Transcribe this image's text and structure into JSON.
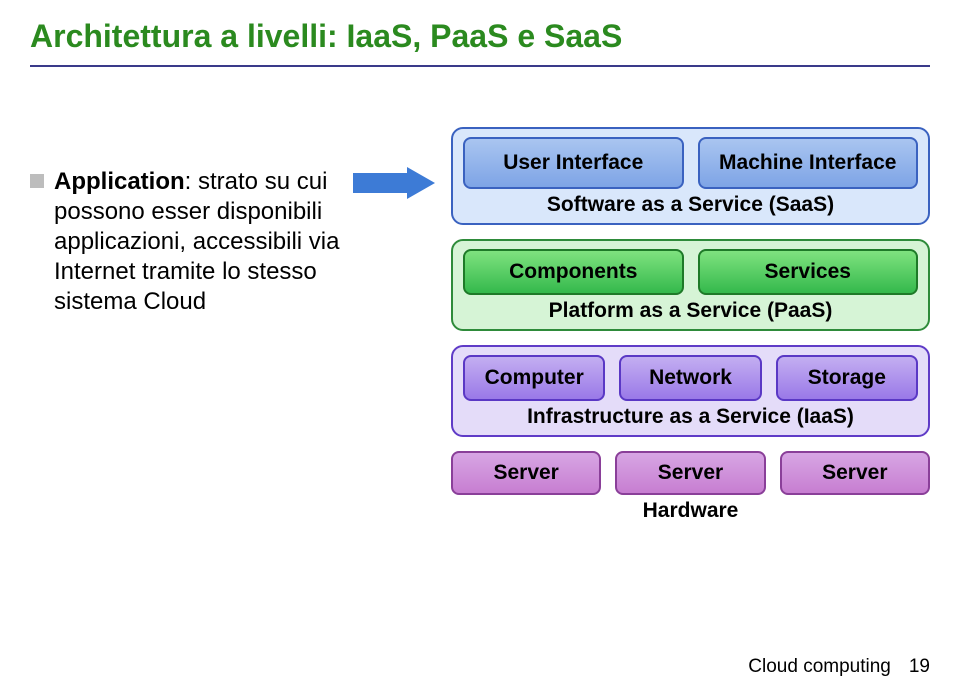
{
  "title": "Architettura a livelli: IaaS, PaaS e SaaS",
  "bullet": {
    "lead": "Application",
    "rest": ": strato su cui possono esser disponibili applicazioni, accessibili via Internet tramite lo stesso sistema Cloud"
  },
  "diagram": {
    "saas": {
      "left": "User Interface",
      "right": "Machine Interface",
      "label": "Software as a Service (SaaS)"
    },
    "paas": {
      "left": "Components",
      "right": "Services",
      "label": "Platform as a Service (PaaS)"
    },
    "iaas": {
      "a": "Computer",
      "b": "Network",
      "c": "Storage",
      "label": "Infrastructure as a Service (IaaS)"
    },
    "hw": {
      "a": "Server",
      "b": "Server",
      "c": "Server",
      "label": "Hardware"
    }
  },
  "footer": {
    "text": "Cloud computing",
    "page": "19"
  }
}
